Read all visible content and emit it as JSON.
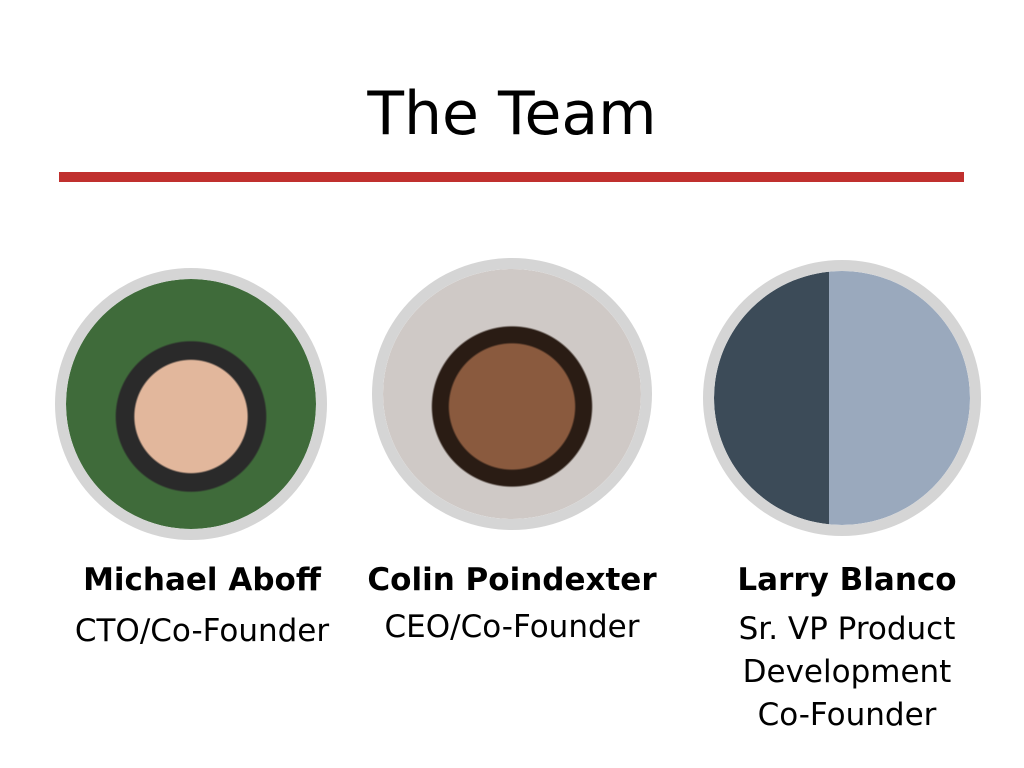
{
  "slide": {
    "title": "The Team",
    "accent_color": "#c0302e",
    "members": [
      {
        "name": "Michael Aboff",
        "role": "CTO/Co-Founder",
        "photo": "portrait-photo"
      },
      {
        "name": "Colin Poindexter",
        "role": "CEO/Co-Founder",
        "photo": "portrait-photo"
      },
      {
        "name": "Larry Blanco",
        "role": "Sr. VP Product\nDevelopment\nCo-Founder",
        "photo": "portrait-photo"
      }
    ]
  }
}
